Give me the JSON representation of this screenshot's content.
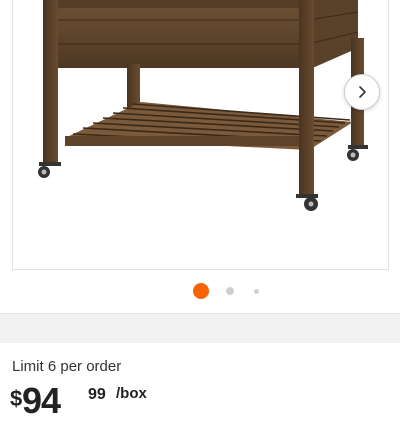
{
  "gallery": {
    "image_alt": "Wooden raised garden bed planter with lower slatted shelf on caster wheels",
    "next_button_icon": "chevron-right-icon",
    "dots": {
      "count": 3,
      "active_index": 0,
      "active_color": "#f96302",
      "inactive_color": "#cfcfcf"
    }
  },
  "product": {
    "limit_text": "Limit 6 per order",
    "price": {
      "currency": "$",
      "dollars": "94",
      "cents": "99",
      "unit": "/box"
    }
  }
}
